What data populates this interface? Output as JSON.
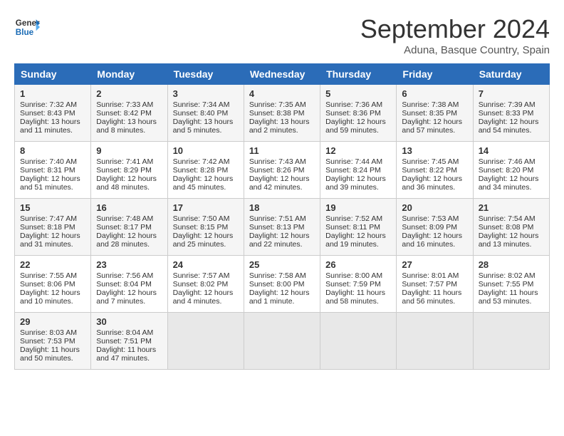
{
  "header": {
    "logo_line1": "General",
    "logo_line2": "Blue",
    "month_title": "September 2024",
    "subtitle": "Aduna, Basque Country, Spain"
  },
  "columns": [
    "Sunday",
    "Monday",
    "Tuesday",
    "Wednesday",
    "Thursday",
    "Friday",
    "Saturday"
  ],
  "weeks": [
    [
      {
        "day": 1,
        "sunrise": "Sunrise: 7:32 AM",
        "sunset": "Sunset: 8:43 PM",
        "daylight": "Daylight: 13 hours and 11 minutes."
      },
      {
        "day": 2,
        "sunrise": "Sunrise: 7:33 AM",
        "sunset": "Sunset: 8:42 PM",
        "daylight": "Daylight: 13 hours and 8 minutes."
      },
      {
        "day": 3,
        "sunrise": "Sunrise: 7:34 AM",
        "sunset": "Sunset: 8:40 PM",
        "daylight": "Daylight: 13 hours and 5 minutes."
      },
      {
        "day": 4,
        "sunrise": "Sunrise: 7:35 AM",
        "sunset": "Sunset: 8:38 PM",
        "daylight": "Daylight: 13 hours and 2 minutes."
      },
      {
        "day": 5,
        "sunrise": "Sunrise: 7:36 AM",
        "sunset": "Sunset: 8:36 PM",
        "daylight": "Daylight: 12 hours and 59 minutes."
      },
      {
        "day": 6,
        "sunrise": "Sunrise: 7:38 AM",
        "sunset": "Sunset: 8:35 PM",
        "daylight": "Daylight: 12 hours and 57 minutes."
      },
      {
        "day": 7,
        "sunrise": "Sunrise: 7:39 AM",
        "sunset": "Sunset: 8:33 PM",
        "daylight": "Daylight: 12 hours and 54 minutes."
      }
    ],
    [
      {
        "day": 8,
        "sunrise": "Sunrise: 7:40 AM",
        "sunset": "Sunset: 8:31 PM",
        "daylight": "Daylight: 12 hours and 51 minutes."
      },
      {
        "day": 9,
        "sunrise": "Sunrise: 7:41 AM",
        "sunset": "Sunset: 8:29 PM",
        "daylight": "Daylight: 12 hours and 48 minutes."
      },
      {
        "day": 10,
        "sunrise": "Sunrise: 7:42 AM",
        "sunset": "Sunset: 8:28 PM",
        "daylight": "Daylight: 12 hours and 45 minutes."
      },
      {
        "day": 11,
        "sunrise": "Sunrise: 7:43 AM",
        "sunset": "Sunset: 8:26 PM",
        "daylight": "Daylight: 12 hours and 42 minutes."
      },
      {
        "day": 12,
        "sunrise": "Sunrise: 7:44 AM",
        "sunset": "Sunset: 8:24 PM",
        "daylight": "Daylight: 12 hours and 39 minutes."
      },
      {
        "day": 13,
        "sunrise": "Sunrise: 7:45 AM",
        "sunset": "Sunset: 8:22 PM",
        "daylight": "Daylight: 12 hours and 36 minutes."
      },
      {
        "day": 14,
        "sunrise": "Sunrise: 7:46 AM",
        "sunset": "Sunset: 8:20 PM",
        "daylight": "Daylight: 12 hours and 34 minutes."
      }
    ],
    [
      {
        "day": 15,
        "sunrise": "Sunrise: 7:47 AM",
        "sunset": "Sunset: 8:18 PM",
        "daylight": "Daylight: 12 hours and 31 minutes."
      },
      {
        "day": 16,
        "sunrise": "Sunrise: 7:48 AM",
        "sunset": "Sunset: 8:17 PM",
        "daylight": "Daylight: 12 hours and 28 minutes."
      },
      {
        "day": 17,
        "sunrise": "Sunrise: 7:50 AM",
        "sunset": "Sunset: 8:15 PM",
        "daylight": "Daylight: 12 hours and 25 minutes."
      },
      {
        "day": 18,
        "sunrise": "Sunrise: 7:51 AM",
        "sunset": "Sunset: 8:13 PM",
        "daylight": "Daylight: 12 hours and 22 minutes."
      },
      {
        "day": 19,
        "sunrise": "Sunrise: 7:52 AM",
        "sunset": "Sunset: 8:11 PM",
        "daylight": "Daylight: 12 hours and 19 minutes."
      },
      {
        "day": 20,
        "sunrise": "Sunrise: 7:53 AM",
        "sunset": "Sunset: 8:09 PM",
        "daylight": "Daylight: 12 hours and 16 minutes."
      },
      {
        "day": 21,
        "sunrise": "Sunrise: 7:54 AM",
        "sunset": "Sunset: 8:08 PM",
        "daylight": "Daylight: 12 hours and 13 minutes."
      }
    ],
    [
      {
        "day": 22,
        "sunrise": "Sunrise: 7:55 AM",
        "sunset": "Sunset: 8:06 PM",
        "daylight": "Daylight: 12 hours and 10 minutes."
      },
      {
        "day": 23,
        "sunrise": "Sunrise: 7:56 AM",
        "sunset": "Sunset: 8:04 PM",
        "daylight": "Daylight: 12 hours and 7 minutes."
      },
      {
        "day": 24,
        "sunrise": "Sunrise: 7:57 AM",
        "sunset": "Sunset: 8:02 PM",
        "daylight": "Daylight: 12 hours and 4 minutes."
      },
      {
        "day": 25,
        "sunrise": "Sunrise: 7:58 AM",
        "sunset": "Sunset: 8:00 PM",
        "daylight": "Daylight: 12 hours and 1 minute."
      },
      {
        "day": 26,
        "sunrise": "Sunrise: 8:00 AM",
        "sunset": "Sunset: 7:59 PM",
        "daylight": "Daylight: 11 hours and 58 minutes."
      },
      {
        "day": 27,
        "sunrise": "Sunrise: 8:01 AM",
        "sunset": "Sunset: 7:57 PM",
        "daylight": "Daylight: 11 hours and 56 minutes."
      },
      {
        "day": 28,
        "sunrise": "Sunrise: 8:02 AM",
        "sunset": "Sunset: 7:55 PM",
        "daylight": "Daylight: 11 hours and 53 minutes."
      }
    ],
    [
      {
        "day": 29,
        "sunrise": "Sunrise: 8:03 AM",
        "sunset": "Sunset: 7:53 PM",
        "daylight": "Daylight: 11 hours and 50 minutes."
      },
      {
        "day": 30,
        "sunrise": "Sunrise: 8:04 AM",
        "sunset": "Sunset: 7:51 PM",
        "daylight": "Daylight: 11 hours and 47 minutes."
      },
      null,
      null,
      null,
      null,
      null
    ]
  ]
}
